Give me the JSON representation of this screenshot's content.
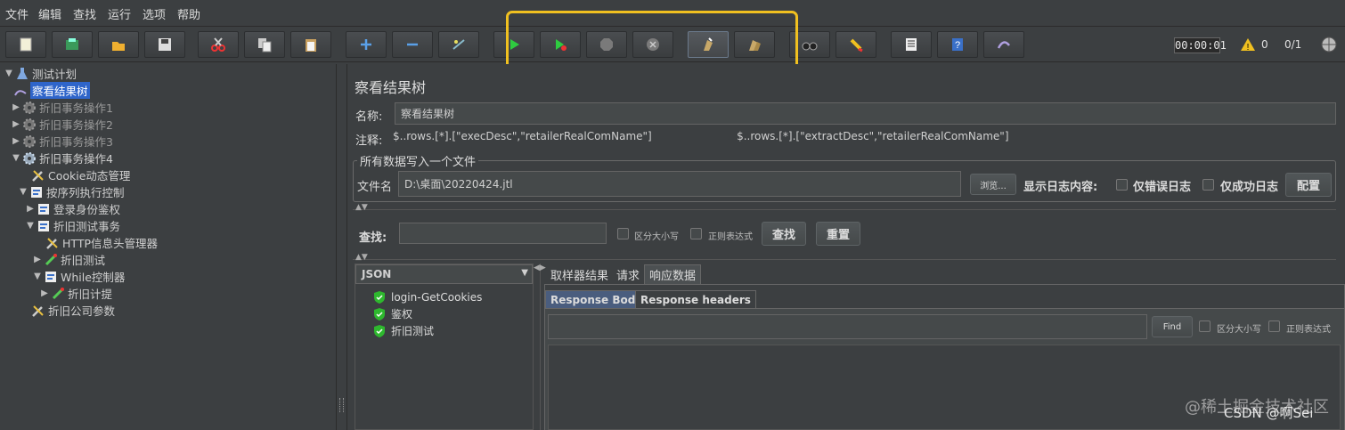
{
  "menubar": {
    "items": [
      "文件",
      "编辑",
      "查找",
      "运行",
      "选项",
      "帮助"
    ]
  },
  "toolbar": {
    "buttons": [
      "new-icon",
      "templates-icon",
      "open-icon",
      "save-icon",
      "cut-icon",
      "copy-icon",
      "paste-icon",
      "expand-icon",
      "collapse-icon",
      "toggle-icon",
      "start-icon",
      "start-no-pause-icon",
      "stop-icon",
      "shutdown-icon",
      "clear-icon",
      "clear-all-icon",
      "search-icon",
      "reset-search-icon",
      "function-helper-icon",
      "help-icon",
      "remote-icon"
    ],
    "timer": "00:00:01",
    "warning_count": "0",
    "thread_ratio": "0/1"
  },
  "tree": {
    "items": [
      {
        "label": "测试计划",
        "icon": "flask-icon",
        "twisty": "▼"
      },
      {
        "label": "察看结果树",
        "icon": "results-tree-icon",
        "twisty": ""
      },
      {
        "label": "折旧事务操作1",
        "icon": "gear-icon",
        "twisty": "▶"
      },
      {
        "label": "折旧事务操作2",
        "icon": "gear-icon",
        "twisty": "▶"
      },
      {
        "label": "折旧事务操作3",
        "icon": "gear-icon",
        "twisty": "▶"
      },
      {
        "label": "折旧事务操作4",
        "icon": "gear-icon",
        "twisty": "▼"
      },
      {
        "label": "Cookie动态管理",
        "icon": "wrench-icon",
        "twisty": ""
      },
      {
        "label": "按序列执行控制",
        "icon": "controller-icon",
        "twisty": "▼"
      },
      {
        "label": "登录身份鉴权",
        "icon": "controller-icon",
        "twisty": "▶"
      },
      {
        "label": "折旧测试事务",
        "icon": "controller-icon",
        "twisty": "▼"
      },
      {
        "label": "HTTP信息头管理器",
        "icon": "wrench-icon",
        "twisty": ""
      },
      {
        "label": "折旧测试",
        "icon": "sampler-icon",
        "twisty": "▶"
      },
      {
        "label": "While控制器",
        "icon": "controller-icon",
        "twisty": "▼"
      },
      {
        "label": "折旧计提",
        "icon": "sampler-icon",
        "twisty": "▶"
      },
      {
        "label": "折旧公司参数",
        "icon": "wrench-icon",
        "twisty": ""
      }
    ]
  },
  "panel": {
    "title": "察看结果树",
    "name_label": "名称:",
    "name_value": "察看结果树",
    "comment_label": "注释:",
    "comment_value": "$..rows.[*].[\"execDesc\",\"retailerRealComName\"]                         $..rows.[*].[\"extractDesc\",\"retailerRealComName\"]",
    "file_group_legend": "所有数据写入一个文件",
    "filename_label": "文件名",
    "filename_value": "D:\\桌面\\20220424.jtl",
    "browse_button": "浏览...",
    "log_label": "显示日志内容:",
    "errors_only": "仅错误日志",
    "success_only": "仅成功日志",
    "configure_button": "配置",
    "search_label": "查找:",
    "case_sensitive": "区分大小写",
    "regex": "正则表达式",
    "search_button": "查找",
    "reset_button": "重置",
    "renderer": "JSON",
    "results": [
      "login-GetCookies",
      "鉴权",
      "折旧测试"
    ],
    "tabs": [
      "取样器结果",
      "请求",
      "响应数据"
    ],
    "subtabs": [
      "Response Body",
      "Response headers"
    ],
    "find_button": "Find",
    "find_case": "区分大小写",
    "find_regex": "正则表达式"
  },
  "watermark": {
    "line1": "@稀土掘金技术社区",
    "line2": "CSDN @啊Sei"
  },
  "colors": {
    "highlight": "#f0c020",
    "selection": "#2f65ca",
    "background": "#3c3f41"
  }
}
